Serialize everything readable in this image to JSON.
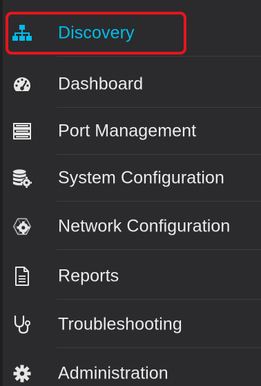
{
  "sidebar": {
    "accent_color": "#00bceb",
    "highlight_color": "#e8141c",
    "items": [
      {
        "label": "Discovery",
        "icon": "hierarchy-icon",
        "active": true
      },
      {
        "label": "Dashboard",
        "icon": "gauge-icon",
        "active": false
      },
      {
        "label": "Port Management",
        "icon": "server-stack-icon",
        "active": false
      },
      {
        "label": "System Configuration",
        "icon": "database-gear-icon",
        "active": false
      },
      {
        "label": "Network Configuration",
        "icon": "network-gear-icon",
        "active": false
      },
      {
        "label": "Reports",
        "icon": "document-icon",
        "active": false
      },
      {
        "label": "Troubleshooting",
        "icon": "stethoscope-icon",
        "active": false
      },
      {
        "label": "Administration",
        "icon": "gear-icon",
        "active": false
      }
    ]
  }
}
